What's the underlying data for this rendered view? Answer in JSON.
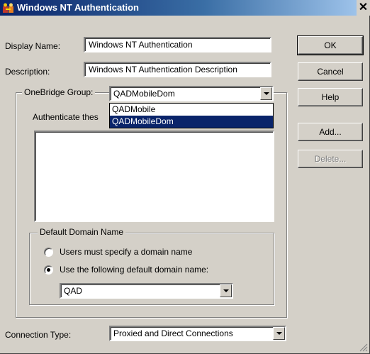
{
  "window": {
    "title": "Windows NT Authentication",
    "app_icon": "key-people-icon",
    "close_glyph": "✕"
  },
  "fields": {
    "display_name_label": "Display Name:",
    "display_name_value": "Windows NT Authentication",
    "description_label": "Description:",
    "description_value": "Windows NT Authentication Description"
  },
  "buttons": {
    "ok": "OK",
    "cancel": "Cancel",
    "help": "Help",
    "add": "Add...",
    "delete": "Delete..."
  },
  "group": {
    "onebridge_label": "OneBridge Group:",
    "onebridge_value": "QADMobileDom",
    "options": [
      "QADMobile",
      "QADMobileDom"
    ],
    "selected_index": 1,
    "authenticate_label": "Authenticate thes"
  },
  "domain": {
    "legend": "Default Domain Name",
    "radio_specify": "Users must specify a domain name",
    "radio_default": "Use the following default domain name:",
    "selected_radio": "default",
    "domain_value": "QAD"
  },
  "connection": {
    "label": "Connection Type:",
    "value": "Proxied and Direct Connections"
  },
  "colors": {
    "title_gradient_start": "#0a246a",
    "title_gradient_end": "#a6caf0",
    "face": "#d4d0c8",
    "selection": "#0a246a"
  }
}
